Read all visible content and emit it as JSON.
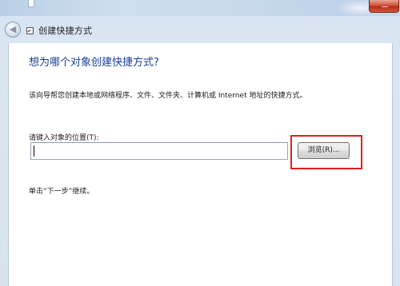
{
  "window": {
    "title": "创建快捷方式",
    "back_icon": "back-arrow-icon",
    "title_icon": "shortcut-icon",
    "close_icon": "close-icon"
  },
  "main": {
    "heading": "想为哪个对象创建快捷方式?",
    "description": "该向导帮您创建本地或网络程序、文件、文件夹、计算机或 Internet 地址的快捷方式。",
    "location_label": "请键入对象的位置(T):",
    "location_value": "",
    "browse_label": "浏览(R)...",
    "instruction": "单击“下一步”继续。"
  },
  "colors": {
    "heading": "#1c3f95",
    "highlight": "#e02020"
  }
}
